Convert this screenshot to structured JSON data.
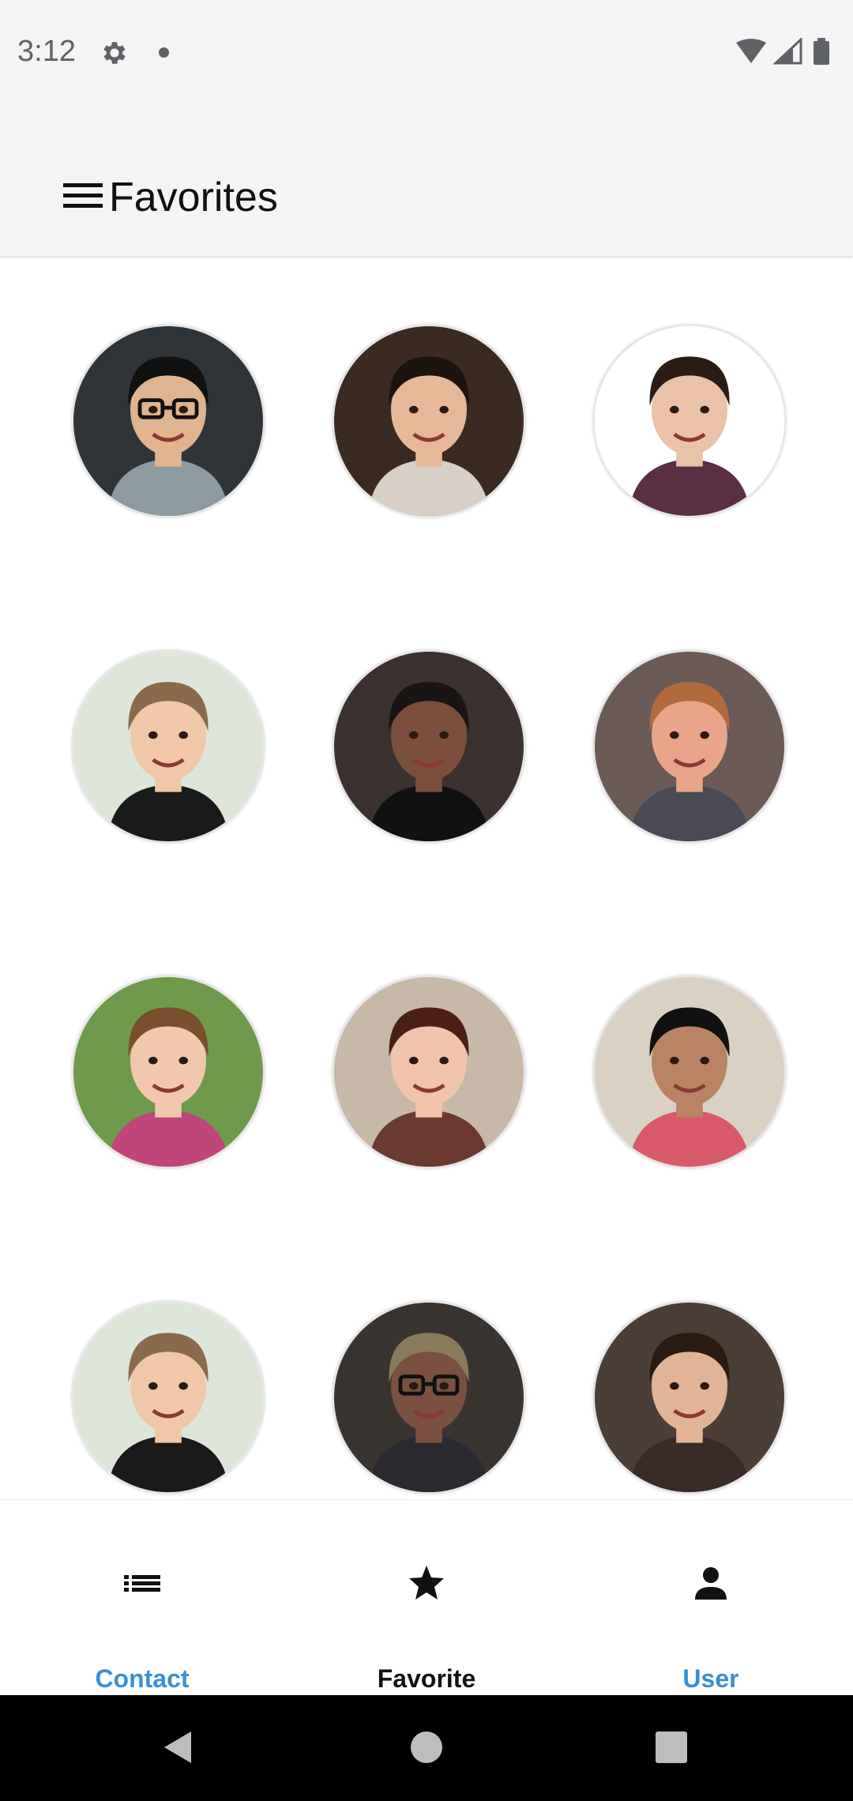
{
  "status_bar": {
    "time": "3:12",
    "icons": [
      "gear-icon",
      "notification-dot",
      "wifi-icon",
      "cell-signal-icon",
      "battery-icon"
    ]
  },
  "app_bar": {
    "title": "Favorites",
    "menu_icon": "hamburger-menu-icon"
  },
  "favorites": [
    {
      "bg": "#2f3438",
      "skin": "#e0b48e",
      "hair": "#111111",
      "shirt": "#8d9aa0",
      "glasses": true
    },
    {
      "bg": "#3a2a22",
      "skin": "#e6b898",
      "hair": "#1d130f",
      "shirt": "#d8cfc6",
      "glasses": false
    },
    {
      "bg": "#ffffff",
      "skin": "#eac2a8",
      "hair": "#2a1c14",
      "shirt": "#5b2e44",
      "glasses": false
    },
    {
      "bg": "#dde6d8",
      "skin": "#f0c8a8",
      "hair": "#8a6a4a",
      "shirt": "#1a1a1a",
      "glasses": false
    },
    {
      "bg": "#3b3230",
      "skin": "#7a4f3c",
      "hair": "#1a1414",
      "shirt": "#111111",
      "glasses": false
    },
    {
      "bg": "#6b5a55",
      "skin": "#e8a58a",
      "hair": "#b06a3e",
      "shirt": "#4a4a55",
      "glasses": false
    },
    {
      "bg": "#6f9a4c",
      "skin": "#f2c8ac",
      "hair": "#7a4e2e",
      "shirt": "#c0457a",
      "glasses": false
    },
    {
      "bg": "#c8b8a8",
      "skin": "#f0c4aa",
      "hair": "#4a1f16",
      "shirt": "#6a3a30",
      "glasses": false
    },
    {
      "bg": "#d9d2c4",
      "skin": "#b88464",
      "hair": "#121010",
      "shirt": "#d95a6a",
      "glasses": false
    },
    {
      "bg": "#dde6d8",
      "skin": "#f0c8a8",
      "hair": "#8a6a4a",
      "shirt": "#1a1a1a",
      "glasses": false
    },
    {
      "bg": "#3a3430",
      "skin": "#7a5040",
      "hair": "#8a7a5a",
      "shirt": "#2a2a30",
      "glasses": true
    },
    {
      "bg": "#4a3e36",
      "skin": "#e2b496",
      "hair": "#2a1a12",
      "shirt": "#3a2a28",
      "glasses": false
    }
  ],
  "bottom_nav": {
    "items": [
      {
        "label": "Contact",
        "icon": "list-icon",
        "color": "#3a8fd6"
      },
      {
        "label": "Favorite",
        "icon": "star-icon",
        "color": "#111111"
      },
      {
        "label": "User",
        "icon": "person-icon",
        "color": "#3a8fd6"
      }
    ]
  },
  "system_nav": {
    "icons": [
      "back-icon",
      "home-icon",
      "recents-icon"
    ]
  }
}
